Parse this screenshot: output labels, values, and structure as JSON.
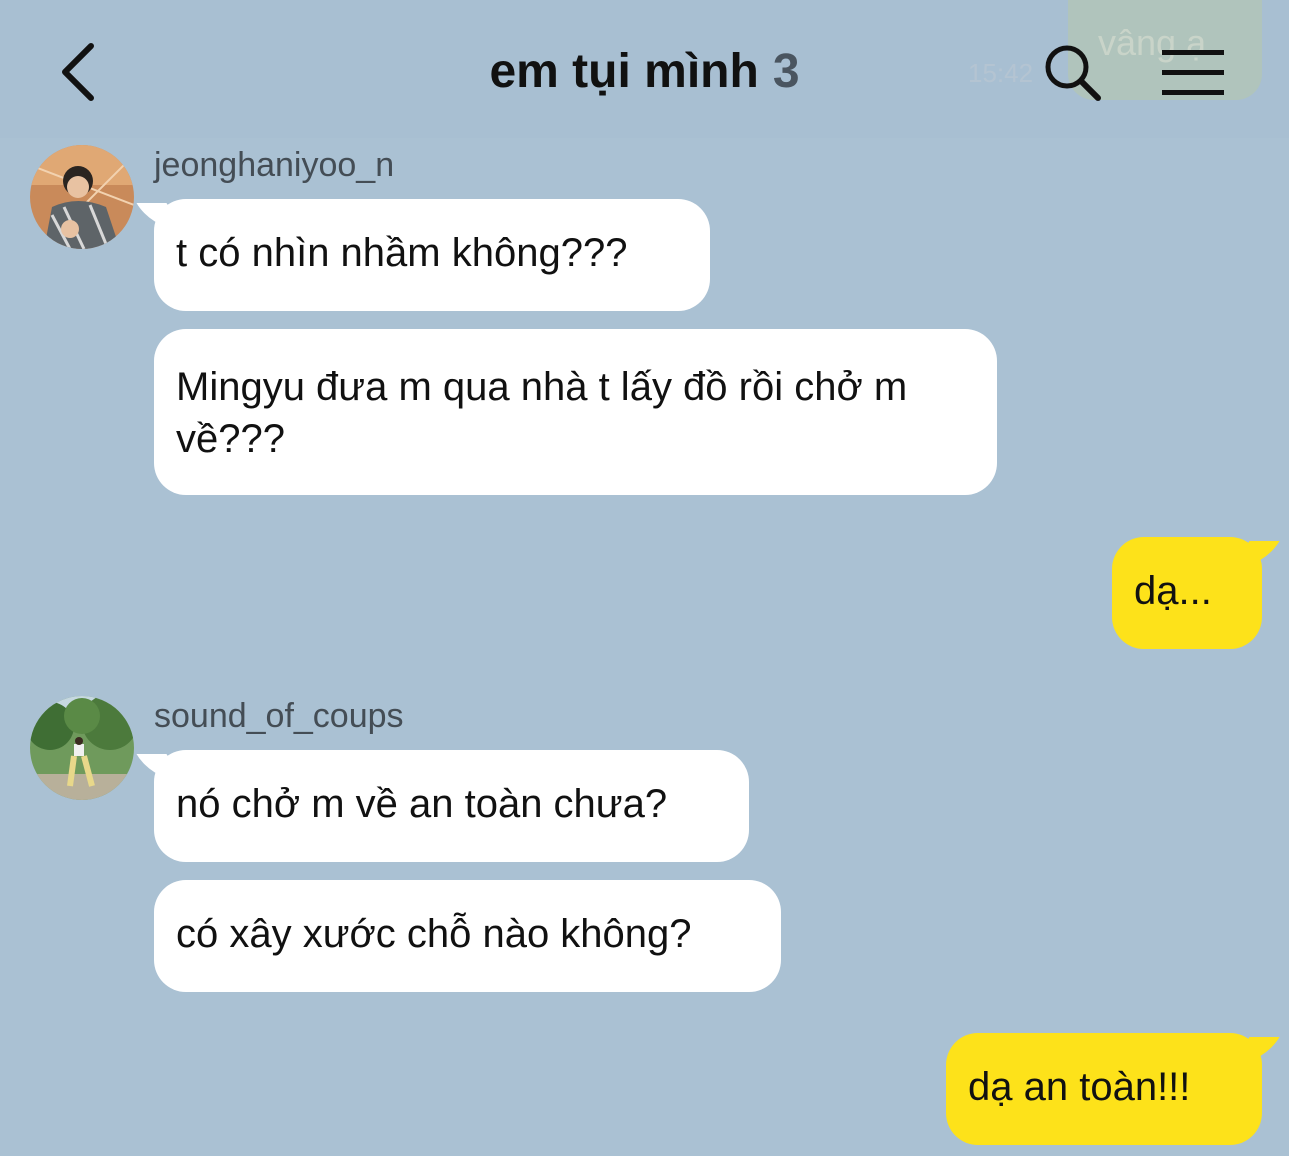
{
  "header": {
    "title": "em tụi mình",
    "member_count": "3",
    "peek_message": "vâng ạ",
    "peek_time": "15:42"
  },
  "messages": [
    {
      "sender": "jeonghaniyoo_n",
      "bubbles": [
        "t có nhìn nhầm không???",
        "Mingyu đưa m qua nhà t lấy đồ rồi chở m về???"
      ]
    },
    {
      "sender": "me",
      "bubbles": [
        "dạ..."
      ]
    },
    {
      "sender": "sound_of_coups",
      "bubbles": [
        "nó chở m về an toàn chưa?",
        "có xây xước chỗ nào không?"
      ]
    },
    {
      "sender": "me",
      "bubbles": [
        "dạ an toàn!!!"
      ]
    }
  ],
  "colors": {
    "background": "#aac1d3",
    "my_bubble": "#fde21a",
    "other_bubble": "#ffffff"
  },
  "icons": [
    "chevron-left-icon",
    "search-icon",
    "hamburger-menu-icon"
  ]
}
